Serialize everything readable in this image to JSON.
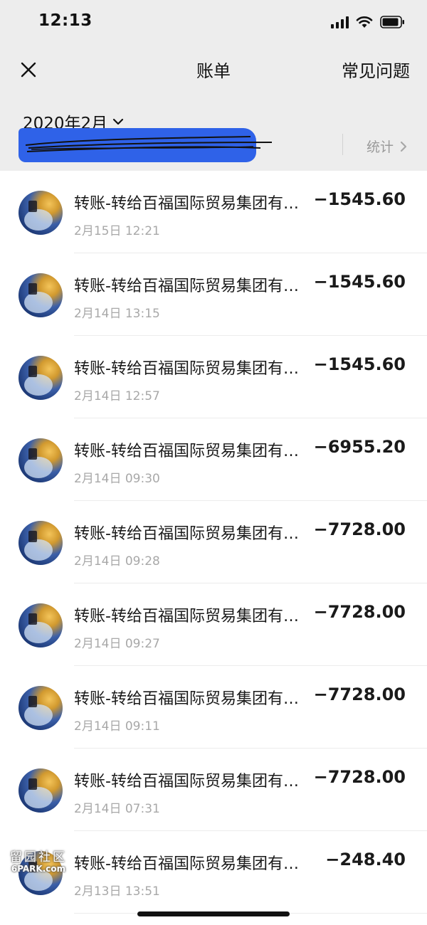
{
  "status_bar": {
    "time": "12:13",
    "icons": [
      "cellular-signal-icon",
      "wifi-icon",
      "battery-icon"
    ]
  },
  "nav": {
    "title": "账单",
    "close_icon": "close-icon",
    "faq_label": "常见问题"
  },
  "header": {
    "month": "2020年2月",
    "month_chevron_icon": "chevron-down-icon",
    "stats_label": "统计",
    "stats_chevron_icon": "chevron-right-icon",
    "redaction_color": "#2f62e8"
  },
  "bills": [
    {
      "title": "转账-转给百福国际贸易集团有…",
      "date": "2月15日 12:21",
      "amount": "−1545.60"
    },
    {
      "title": "转账-转给百福国际贸易集团有…",
      "date": "2月14日 13:15",
      "amount": "−1545.60"
    },
    {
      "title": "转账-转给百福国际贸易集团有…",
      "date": "2月14日 12:57",
      "amount": "−1545.60"
    },
    {
      "title": "转账-转给百福国际贸易集团有…",
      "date": "2月14日 09:30",
      "amount": "−6955.20"
    },
    {
      "title": "转账-转给百福国际贸易集团有…",
      "date": "2月14日 09:28",
      "amount": "−7728.00"
    },
    {
      "title": "转账-转给百福国际贸易集团有…",
      "date": "2月14日 09:27",
      "amount": "−7728.00"
    },
    {
      "title": "转账-转给百福国际贸易集团有…",
      "date": "2月14日 09:11",
      "amount": "−7728.00"
    },
    {
      "title": "转账-转给百福国际贸易集团有…",
      "date": "2月14日 07:31",
      "amount": "−7728.00"
    },
    {
      "title": "转账-转给百福国际贸易集团有…",
      "date": "2月13日 13:51",
      "amount": "−248.40"
    }
  ],
  "watermark": {
    "text_cn": "留园社区",
    "text_en": "6PARK.com"
  }
}
